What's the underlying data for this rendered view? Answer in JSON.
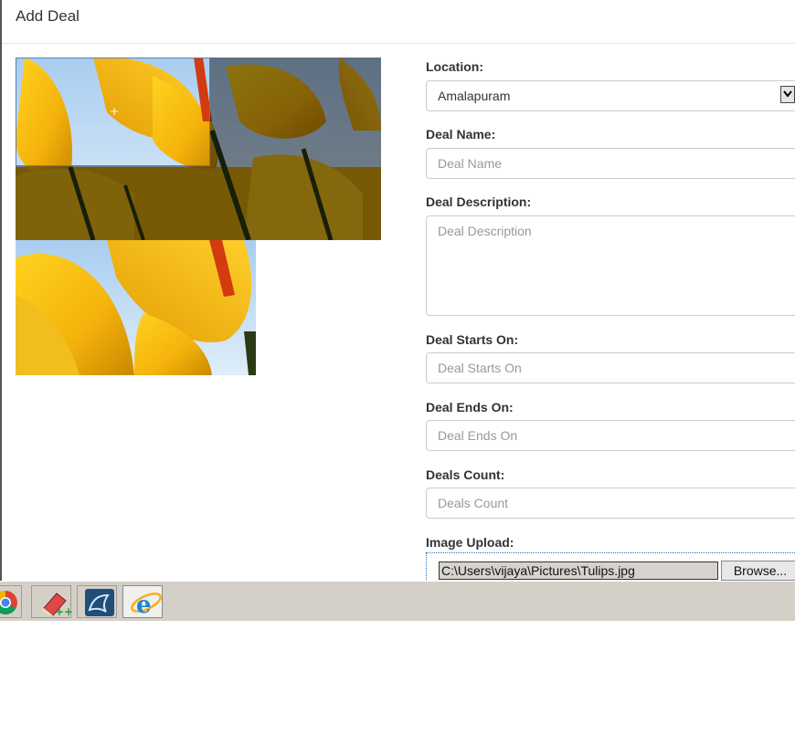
{
  "dialog": {
    "title": "Add Deal"
  },
  "form": {
    "location": {
      "label": "Location:",
      "value": "Amalapuram"
    },
    "deal_name": {
      "label": "Deal Name:",
      "placeholder": "Deal Name"
    },
    "deal_description": {
      "label": "Deal Description:",
      "placeholder": "Deal Description"
    },
    "deal_starts_on": {
      "label": "Deal Starts On:",
      "placeholder": "Deal Starts On"
    },
    "deal_ends_on": {
      "label": "Deal Ends On:",
      "placeholder": "Deal Ends On"
    },
    "deals_count": {
      "label": "Deals Count:",
      "placeholder": "Deals Count"
    },
    "image_upload": {
      "label": "Image Upload:",
      "file_path": "C:\\Users\\vijaya\\Pictures\\Tulips.jpg",
      "browse_label": "Browse..."
    }
  },
  "image": {
    "crosshair": "+"
  },
  "taskbar": {
    "apps": [
      {
        "icon": "chrome-icon"
      },
      {
        "icon": "eraser-icon"
      },
      {
        "icon": "mysql-workbench-icon"
      },
      {
        "icon": "internet-explorer-icon",
        "active": true
      }
    ]
  },
  "colors": {
    "accent": "#2a6db3",
    "taskbar": "#d4d0c8",
    "label": "#333333",
    "placeholder": "#999999"
  }
}
